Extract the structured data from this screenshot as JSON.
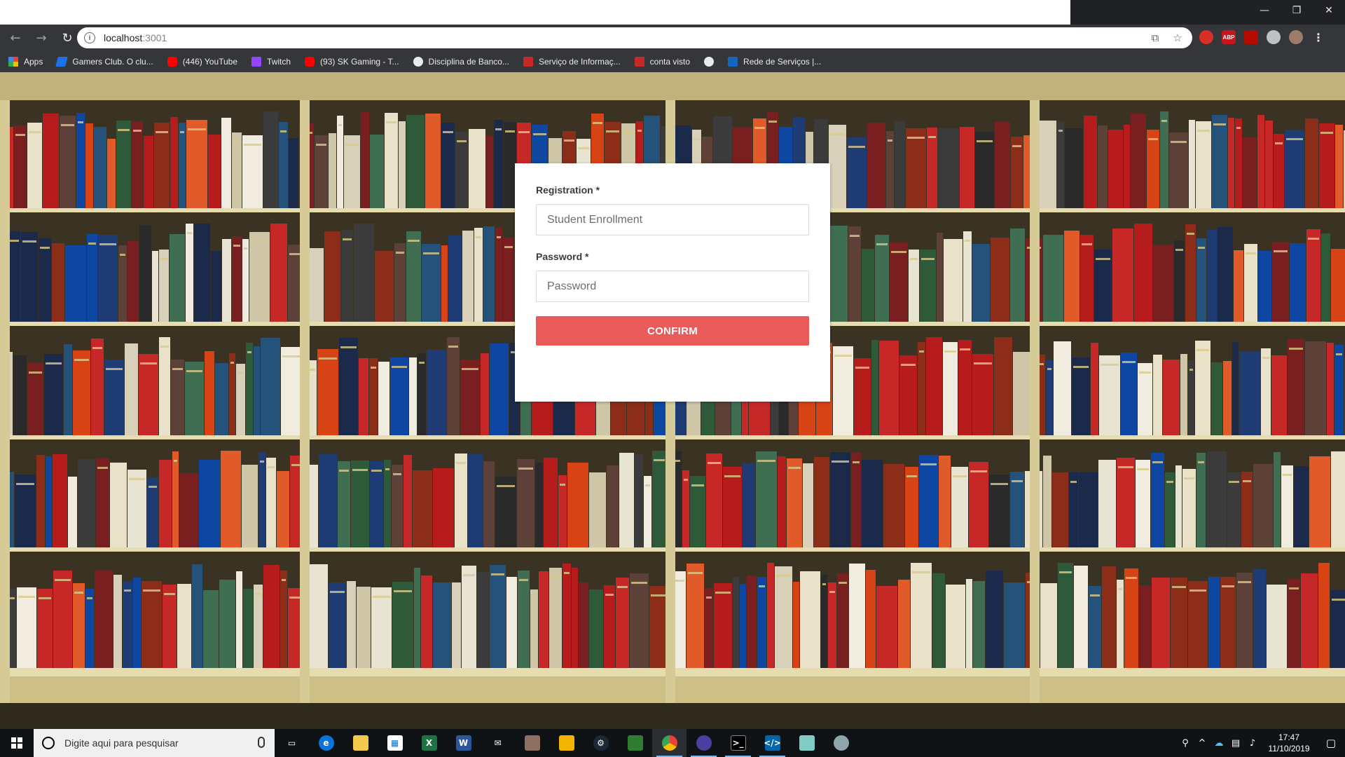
{
  "browser": {
    "window_controls": {
      "minimize": "—",
      "maximize": "❐",
      "close": "✕"
    },
    "nav": {
      "back": "←",
      "forward": "→",
      "reload": "↻"
    },
    "address": {
      "host": "localhost",
      "port": ":3001"
    },
    "bookmarks": [
      {
        "label": "Apps",
        "icon": "apps-grid-icon"
      },
      {
        "label": "Gamers Club. O clu...",
        "icon": "gamers-club-icon"
      },
      {
        "label": "(446) YouTube",
        "icon": "youtube-icon"
      },
      {
        "label": "Twitch",
        "icon": "twitch-icon"
      },
      {
        "label": "(93) SK Gaming - T...",
        "icon": "youtube-icon"
      },
      {
        "label": "Disciplina de Banco...",
        "icon": "globe-icon"
      },
      {
        "label": "Serviço de Informaç...",
        "icon": "red-bird-icon"
      },
      {
        "label": "conta visto",
        "icon": "red-bird-icon"
      },
      {
        "label": "",
        "icon": "globe-icon"
      },
      {
        "label": "Rede de Serviços |...",
        "icon": "blue-app-icon"
      }
    ],
    "extensions": {
      "abp": "ABP"
    }
  },
  "login": {
    "registration_label": "Registration *",
    "registration_placeholder": "Student Enrollment",
    "password_label": "Password *",
    "password_placeholder": "Password",
    "confirm_label": "CONFIRM"
  },
  "taskbar": {
    "search_placeholder": "Digite aqui para pesquisar",
    "time": "17:47",
    "date": "11/10/2019"
  },
  "colors": {
    "confirm_button": "#e95a5a",
    "browser_toolbar": "#35363a",
    "taskbar": "#101316"
  }
}
